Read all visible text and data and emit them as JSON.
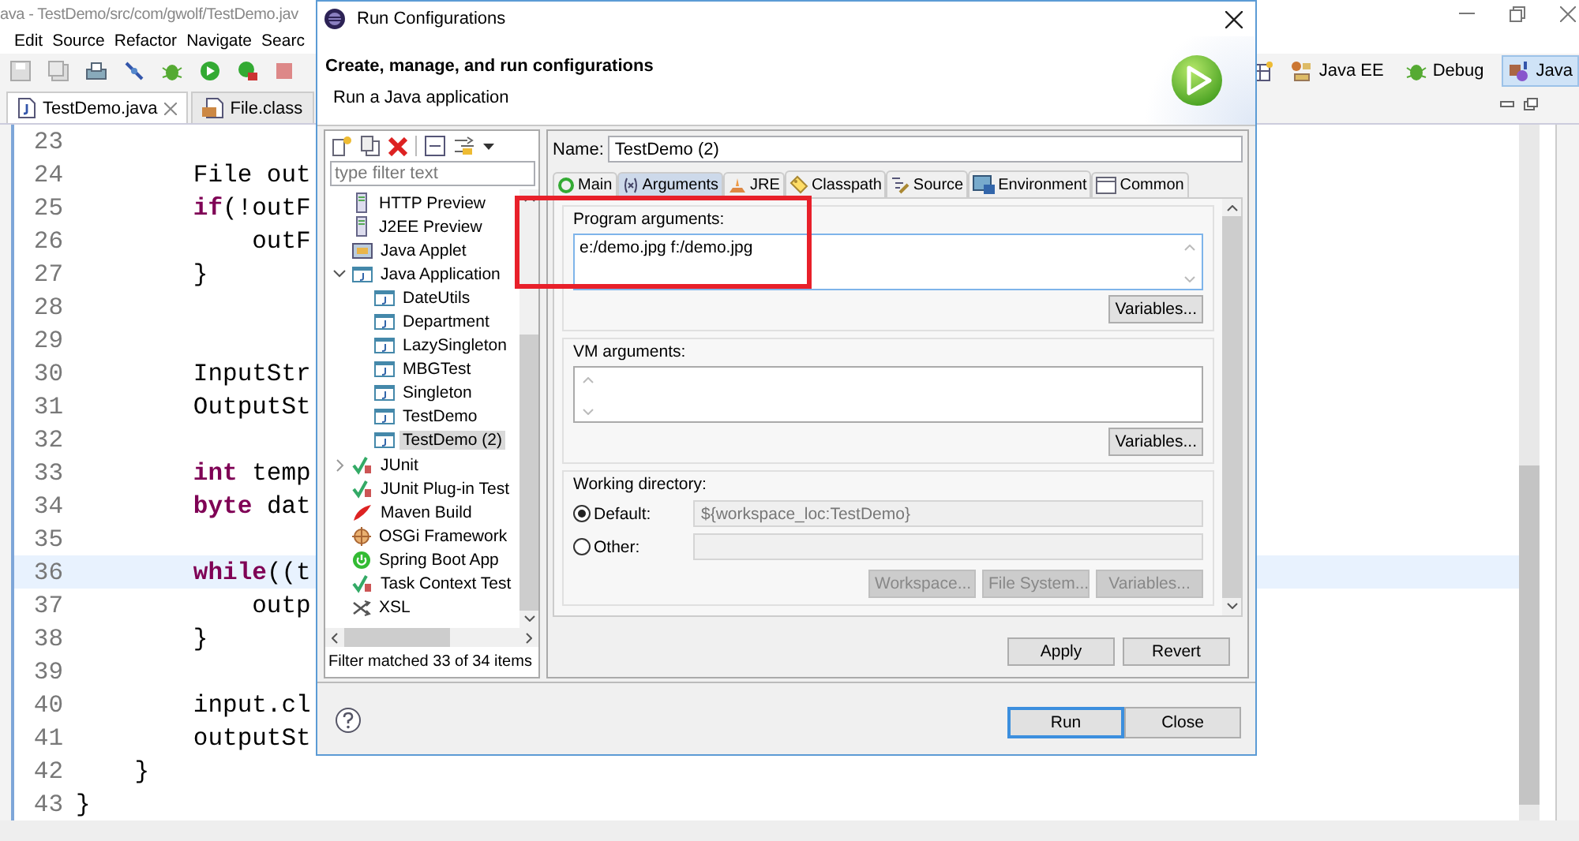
{
  "ide": {
    "title": "ava - TestDemo/src/com/gwolf/TestDemo.jav",
    "menu": [
      "Edit",
      "Source",
      "Refactor",
      "Navigate",
      "Searc"
    ],
    "perspectives": [
      {
        "label": "Java EE",
        "kind": "javaee",
        "selected": false
      },
      {
        "label": "Debug",
        "kind": "debug",
        "selected": false
      },
      {
        "label": "Java",
        "kind": "java",
        "selected": true
      }
    ],
    "editor_tabs": [
      {
        "label": "TestDemo.java",
        "kind": "java",
        "selected": true
      },
      {
        "label": "File.class",
        "kind": "class",
        "selected": false
      }
    ],
    "lines": [
      {
        "number": "23",
        "current": false
      },
      {
        "number": "24",
        "current": false,
        "code": "        File out"
      },
      {
        "number": "25",
        "current": false,
        "code": "        **if**(!outF"
      },
      {
        "number": "26",
        "current": false,
        "code": "            outF"
      },
      {
        "number": "27",
        "current": false,
        "code": "        }"
      },
      {
        "number": "28",
        "current": false
      },
      {
        "number": "29",
        "current": false
      },
      {
        "number": "30",
        "current": false,
        "code": "        InputStr"
      },
      {
        "number": "31",
        "current": false,
        "code": "        OutputSt"
      },
      {
        "number": "32",
        "current": false
      },
      {
        "number": "33",
        "current": false,
        "code": "        **int** temp"
      },
      {
        "number": "34",
        "current": false,
        "code": "        **byte** dat"
      },
      {
        "number": "35",
        "current": false
      },
      {
        "number": "36",
        "current": true,
        "code": "        **while**((t"
      },
      {
        "number": "37",
        "current": false,
        "code": "            outp"
      },
      {
        "number": "38",
        "current": false,
        "code": "        }"
      },
      {
        "number": "39",
        "current": false
      },
      {
        "number": "40",
        "current": false,
        "code": "        input.cl"
      },
      {
        "number": "41",
        "current": false,
        "code": "        outputSt"
      },
      {
        "number": "42",
        "current": false,
        "code": "    }"
      },
      {
        "number": "43",
        "current": false,
        "code": "}"
      }
    ]
  },
  "dialog": {
    "title": "Run Configurations",
    "heading": "Create, manage, and run configurations",
    "subheading": "Run a Java application",
    "filter": {
      "placeholder": "type filter text"
    },
    "tree": [
      {
        "label": "HTTP Preview",
        "kind": "server",
        "selected": false
      },
      {
        "label": "J2EE Preview",
        "kind": "server",
        "selected": false
      },
      {
        "label": "Java Applet",
        "kind": "applet",
        "selected": false
      },
      {
        "label": "Java Application",
        "kind": "java",
        "selected": false,
        "expanded": true,
        "children": [
          {
            "label": "DateUtils",
            "kind": "java",
            "selected": false
          },
          {
            "label": "Department",
            "kind": "java",
            "selected": false
          },
          {
            "label": "LazySingleton",
            "kind": "java",
            "selected": false
          },
          {
            "label": "MBGTest",
            "kind": "java",
            "selected": false
          },
          {
            "label": "Singleton",
            "kind": "java",
            "selected": false
          },
          {
            "label": "TestDemo",
            "kind": "java",
            "selected": false
          },
          {
            "label": "TestDemo (2)",
            "kind": "java",
            "selected": true
          }
        ]
      },
      {
        "label": "JUnit",
        "kind": "junit",
        "selected": false,
        "expanded": false
      },
      {
        "label": "JUnit Plug-in Test",
        "kind": "junit",
        "selected": false
      },
      {
        "label": "Maven Build",
        "kind": "maven",
        "selected": false
      },
      {
        "label": "OSGi Framework",
        "kind": "osgi",
        "selected": false
      },
      {
        "label": "Spring Boot App",
        "kind": "spring",
        "selected": false
      },
      {
        "label": "Task Context Test",
        "kind": "junit",
        "selected": false
      },
      {
        "label": "XSL",
        "kind": "xsl",
        "selected": false
      }
    ],
    "filter_status": "Filter matched 33 of 34 items",
    "name_label": "Name:",
    "name": "TestDemo (2)",
    "tabs": [
      {
        "label": "Main",
        "kind": "main",
        "selected": false
      },
      {
        "label": "Arguments",
        "kind": "arguments",
        "selected": true
      },
      {
        "label": "JRE",
        "kind": "jre",
        "selected": false
      },
      {
        "label": "Classpath",
        "kind": "classpath",
        "selected": false
      },
      {
        "label": "Source",
        "kind": "source",
        "selected": false
      },
      {
        "label": "Environment",
        "kind": "environment",
        "selected": false
      },
      {
        "label": "Common",
        "kind": "common",
        "selected": false
      }
    ],
    "program_args": {
      "label": "Program arguments:",
      "value": "e:/demo.jpg f:/demo.jpg",
      "button": "Variables..."
    },
    "vm_args": {
      "label": "VM arguments:",
      "button": "Variables..."
    },
    "working_directory": {
      "label": "Working directory:",
      "options": [
        {
          "label": "Default:",
          "selected": true,
          "value": "${workspace_loc:TestDemo}"
        },
        {
          "label": "Other:",
          "selected": false
        }
      ],
      "buttons": [
        {
          "label": "Workspace...",
          "disabled": true
        },
        {
          "label": "File System...",
          "disabled": true
        },
        {
          "label": "Variables...",
          "disabled": true
        }
      ]
    },
    "actions": [
      {
        "label": "Apply",
        "disabled": false
      },
      {
        "label": "Revert",
        "disabled": false
      }
    ],
    "footer_buttons": [
      {
        "label": "Run",
        "default": true
      },
      {
        "label": "Close",
        "default": false
      }
    ]
  }
}
